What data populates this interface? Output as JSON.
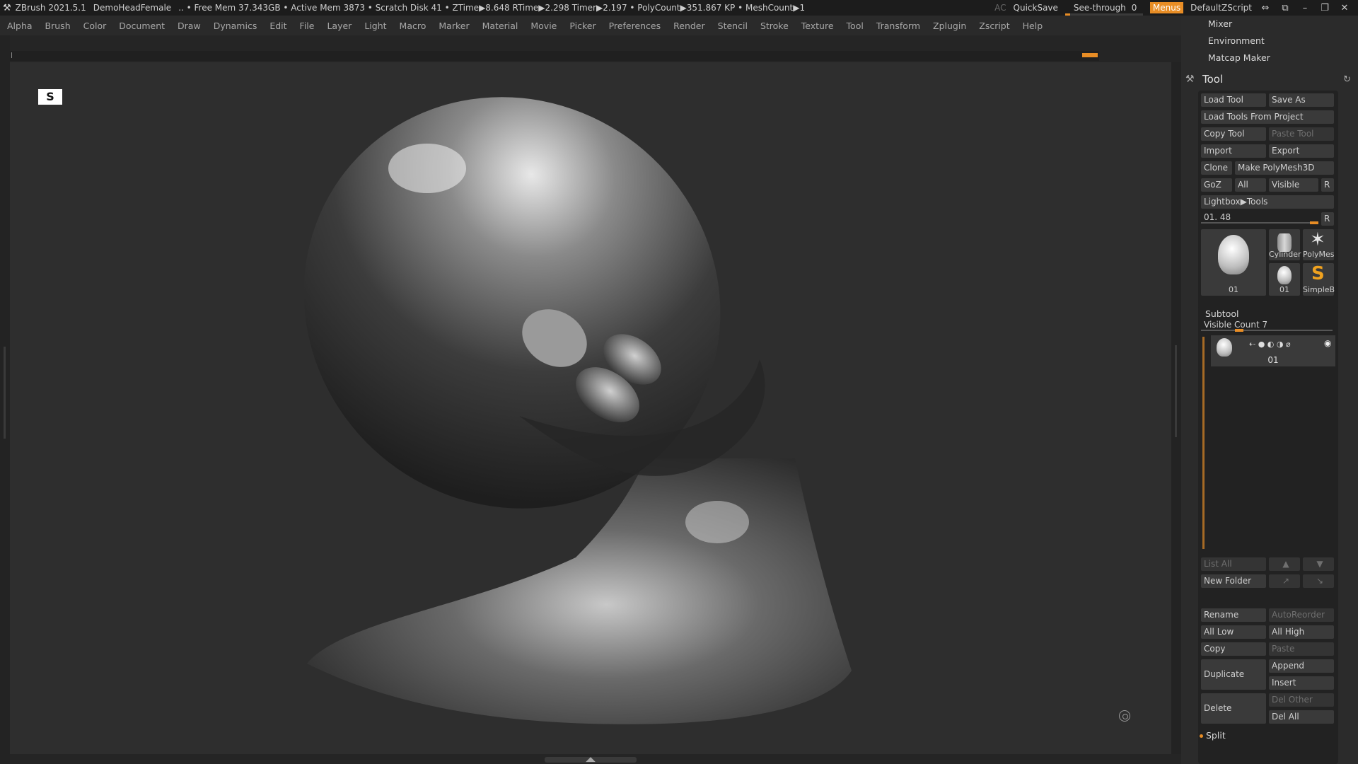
{
  "titlebar": {
    "app": "ZBrush 2021.5.1",
    "document": "DemoHeadFemale",
    "stats": ".. • Free Mem 37.343GB • Active Mem 3873 • Scratch Disk 41 • ZTime▶8.648 RTime▶2.298 Timer▶2.197 • PolyCount▶351.867 KP • MeshCount▶1",
    "ac": "AC",
    "quicksave": "QuickSave",
    "seethrough_label": "See-through",
    "seethrough_value": "0",
    "seethrough_fraction": 0.06,
    "menus": "Menus",
    "script": "DefaultZScript",
    "win_buttons": [
      "⇔",
      "⧉",
      "–",
      "❐",
      "✕"
    ]
  },
  "menubar": [
    "Alpha",
    "Brush",
    "Color",
    "Document",
    "Draw",
    "Dynamics",
    "Edit",
    "File",
    "Layer",
    "Light",
    "Macro",
    "Marker",
    "Material",
    "Movie",
    "Picker",
    "Preferences",
    "Render",
    "Stencil",
    "Stroke",
    "Texture",
    "Tool",
    "Transform",
    "Zplugin",
    "Zscript",
    "Help"
  ],
  "panel": {
    "menus": [
      "Mixer",
      "Environment",
      "Matcap Maker"
    ],
    "tool_title": "Tool",
    "buttons": {
      "load_tool": "Load Tool",
      "save_as": "Save As",
      "load_from_project": "Load Tools From Project",
      "copy_tool": "Copy Tool",
      "paste_tool": "Paste Tool",
      "import": "Import",
      "export": "Export",
      "clone": "Clone",
      "make_polymesh": "Make PolyMesh3D",
      "goz": "GoZ",
      "all": "All",
      "visible": "Visible",
      "r": "R",
      "lightbox": "Lightbox▶Tools"
    },
    "tool_slider": {
      "label": "01. 48",
      "r": "R"
    },
    "thumbs": {
      "main": "01",
      "cylinder": "Cylinder",
      "polymesh": "PolyMes",
      "small": "01",
      "simple": "SimpleB"
    },
    "subtool": {
      "title": "Subtool",
      "visible_count": "Visible Count 7",
      "item_label": "01",
      "list_all": "List All",
      "new_folder": "New Folder",
      "rename": "Rename",
      "autoreorder": "AutoReorder",
      "all_low": "All Low",
      "all_high": "All High",
      "copy": "Copy",
      "paste": "Paste",
      "duplicate": "Duplicate",
      "append": "Append",
      "insert": "Insert",
      "delete": "Delete",
      "del_other": "Del Other",
      "del_all": "Del All",
      "split": "Split"
    }
  }
}
